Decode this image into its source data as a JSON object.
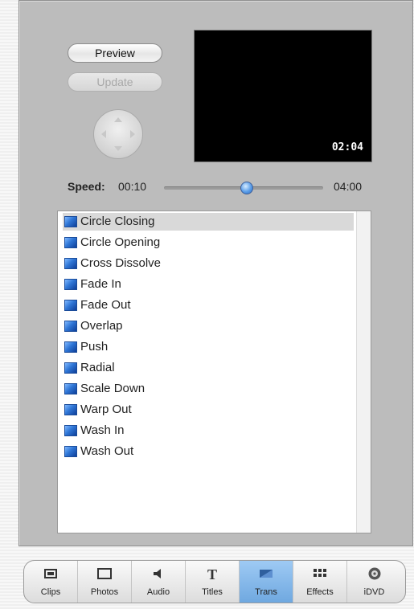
{
  "preview_controls": {
    "preview_label": "Preview",
    "update_label": "Update",
    "timecode": "02:04"
  },
  "speed": {
    "label": "Speed:",
    "min": "00:10",
    "max": "04:00",
    "slider_fraction": 0.52
  },
  "transitions": [
    {
      "label": "Circle Closing",
      "selected": true
    },
    {
      "label": "Circle Opening",
      "selected": false
    },
    {
      "label": "Cross Dissolve",
      "selected": false
    },
    {
      "label": "Fade In",
      "selected": false
    },
    {
      "label": "Fade Out",
      "selected": false
    },
    {
      "label": "Overlap",
      "selected": false
    },
    {
      "label": "Push",
      "selected": false
    },
    {
      "label": "Radial",
      "selected": false
    },
    {
      "label": "Scale Down",
      "selected": false
    },
    {
      "label": "Warp Out",
      "selected": false
    },
    {
      "label": "Wash In",
      "selected": false
    },
    {
      "label": "Wash Out",
      "selected": false
    }
  ],
  "toolbar": [
    {
      "label": "Clips",
      "icon": "clips-icon",
      "active": false
    },
    {
      "label": "Photos",
      "icon": "photos-icon",
      "active": false
    },
    {
      "label": "Audio",
      "icon": "audio-icon",
      "active": false
    },
    {
      "label": "Titles",
      "icon": "titles-icon",
      "active": false
    },
    {
      "label": "Trans",
      "icon": "transitions-icon",
      "active": true
    },
    {
      "label": "Effects",
      "icon": "effects-icon",
      "active": false
    },
    {
      "label": "iDVD",
      "icon": "idvd-icon",
      "active": false
    }
  ],
  "colors": {
    "accent": "#5a9de8",
    "active_tab": "#8dbdea",
    "panel": "#bcbcbc"
  }
}
